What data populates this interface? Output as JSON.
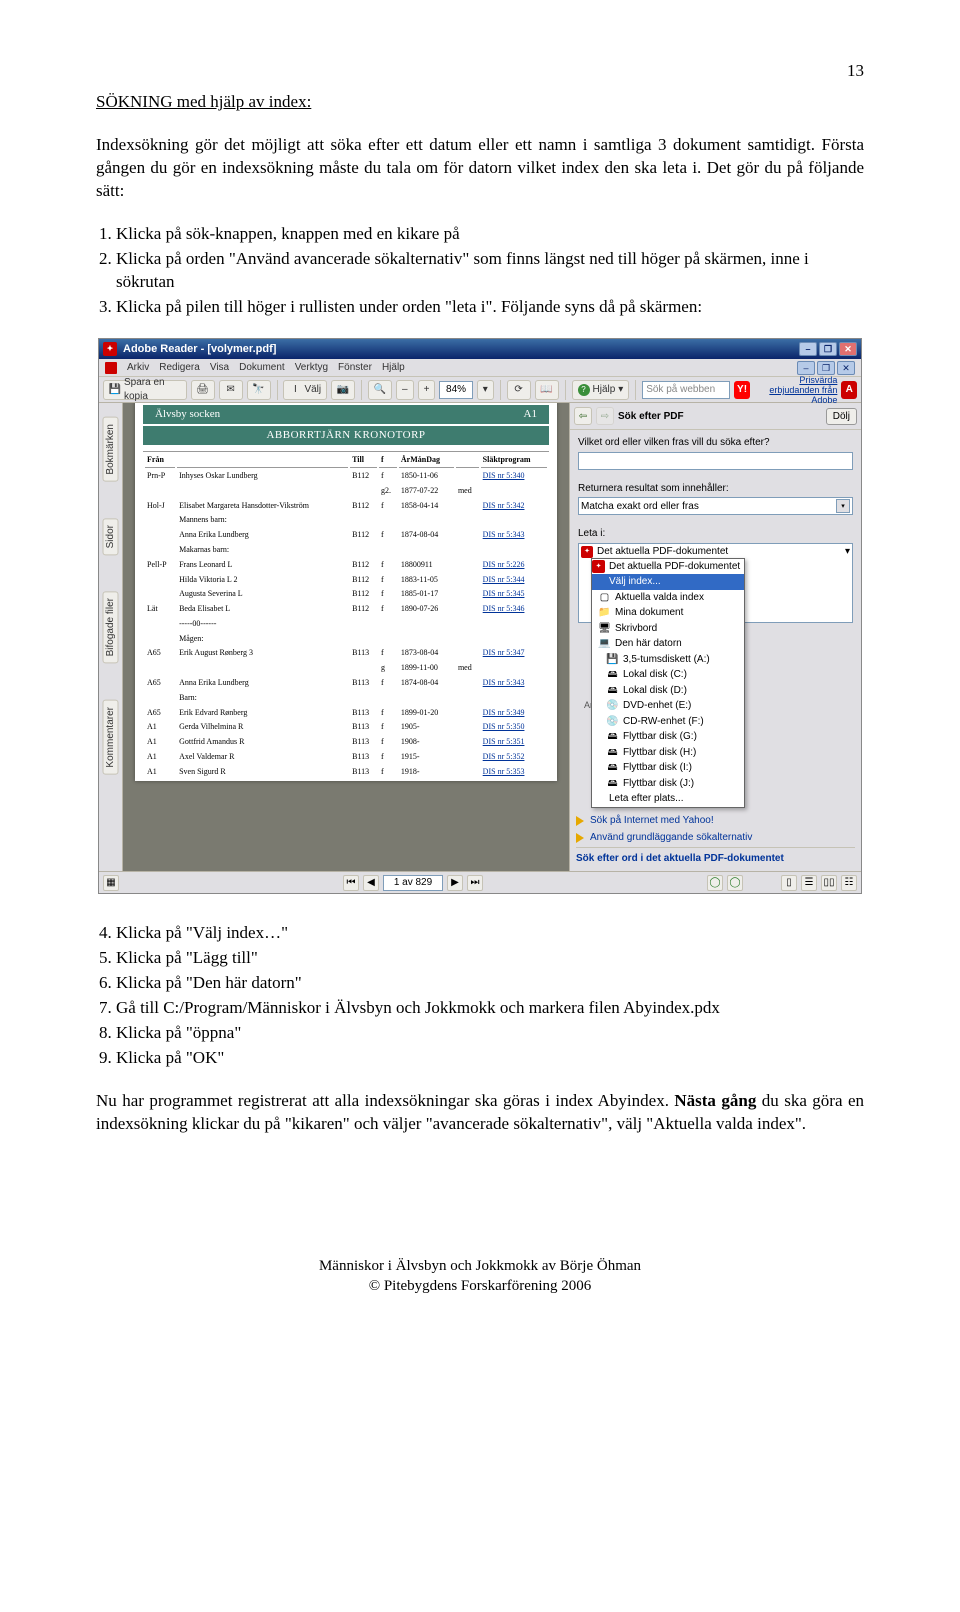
{
  "pageNumber": "13",
  "heading": "SÖKNING med hjälp av index:",
  "para1": "Indexsökning gör det möjligt att söka efter ett datum eller ett namn i samtliga 3 dokument samtidigt. Första gången du gör en indexsökning måste du tala om för datorn vilket index den ska leta i. Det gör du på följande sätt:",
  "steps1": [
    "Klicka på sök-knappen, knappen med en kikare på",
    "Klicka på orden \"Använd avancerade sökalternativ\" som finns längst ned till höger på skärmen, inne i sökrutan",
    "Klicka på pilen till höger i rullisten under orden \"leta i\". Följande syns då på skärmen:"
  ],
  "steps2": [
    "Klicka på  \"Välj index…\"",
    "Klicka på \"Lägg till\"",
    "Klicka på \"Den här datorn\"",
    "Gå till C:/Program/Människor i Älvsbyn och Jokkmokk och markera filen Abyindex.pdx",
    "Klicka på \"öppna\"",
    "Klicka på \"OK\""
  ],
  "para2": "Nu har programmet registrerat att alla indexsökningar ska göras i index Abyindex. Nästa gång du ska göra en indexsökning klickar du på \"kikaren\" och väljer \"avancerade sökalternativ\", välj \"Aktuella valda index\".",
  "footer1": "Människor i Älvsbyn och Jokkmokk av Börje Öhman",
  "footer2": "© Pitebygdens Forskarförening 2006",
  "shot": {
    "title": "Adobe Reader - [volymer.pdf]",
    "menu": [
      "Arkiv",
      "Redigera",
      "Visa",
      "Dokument",
      "Verktyg",
      "Fönster",
      "Hjälp"
    ],
    "toolbar": {
      "save": "Spara en kopia",
      "select": "Välj",
      "zoom": "84%",
      "help": "Hjälp",
      "searchPlaceholder": "Sök på webben",
      "promo": "Prisvärda erbjudanden från Adobe"
    },
    "leftTabs": [
      "Bokmärken",
      "Sidor",
      "Bifogade filer",
      "Kommentarer"
    ],
    "doc": {
      "banner1L": "Älvsby socken",
      "banner1R": "A1",
      "banner2": "ABBORRTJÄRN  KRONOTORP",
      "headers": [
        "Från",
        "",
        "Till",
        "f",
        "ÅrMånDag",
        "",
        "Släktprogram"
      ],
      "rows": [
        [
          "Prn-P",
          "Inhyses  Oskar Lundberg",
          "B112",
          "f",
          "1850-11-06",
          "",
          "DIS nr 5:340"
        ],
        [
          "",
          "",
          "",
          "g2.",
          "1877-07-22",
          "med",
          ""
        ],
        [
          "Hol-J",
          "Elisabet Margareta Hansdotter-Vikström",
          "B112",
          "f",
          "1858-04-14",
          "",
          "DIS nr 5:342"
        ],
        [
          "",
          "Mannens barn:",
          "",
          "",
          "",
          "",
          ""
        ],
        [
          "",
          "Anna Erika Lundberg",
          "B112",
          "f",
          "1874-08-04",
          "",
          "DIS nr 5:343"
        ],
        [
          "",
          "Makarnas barn:",
          "",
          "",
          "",
          "",
          ""
        ],
        [
          "Pell-P",
          "Frans Leonard L",
          "B112",
          "f",
          "18800911",
          "",
          "DIS nr 5:226"
        ],
        [
          "",
          "Hilda Viktoria L 2",
          "B112",
          "f",
          "1883-11-05",
          "",
          "DIS nr 5:344"
        ],
        [
          "",
          "Augusta Severina L",
          "B112",
          "f",
          "1885-01-17",
          "",
          "DIS nr 5:345"
        ],
        [
          "Lät",
          "Beda Elisabet L",
          "B112",
          "f",
          "1890-07-26",
          "",
          "DIS nr 5:346"
        ],
        [
          "",
          "-----00------",
          "",
          "",
          "",
          "",
          ""
        ],
        [
          "",
          "Mågen:",
          "",
          "",
          "",
          "",
          ""
        ],
        [
          "A65",
          "Erik August Rønberg 3",
          "B113",
          "f",
          "1873-08-04",
          "",
          "DIS nr 5:347"
        ],
        [
          "",
          "",
          "",
          "g",
          "1899-11-00",
          "med",
          ""
        ],
        [
          "A65",
          "Anna Erika Lundberg",
          "B113",
          "f",
          "1874-08-04",
          "",
          "DIS nr 5:343"
        ],
        [
          "",
          "Barn:",
          "",
          "",
          "",
          "",
          ""
        ],
        [
          "A65",
          "Erik Edvard Rønberg",
          "B113",
          "f",
          "1899-01-20",
          "",
          "DIS nr 5:349"
        ],
        [
          "A1",
          "Gerda Vilhelmina R",
          "B113",
          "f",
          "1905-",
          "",
          "DIS nr 5:350"
        ],
        [
          "A1",
          "Gottfrid Amandus R",
          "B113",
          "f",
          "1908-",
          "",
          "DIS nr 5:351"
        ],
        [
          "A1",
          "Axel Valdemar R",
          "B113",
          "f",
          "1915-",
          "",
          "DIS nr 5:352"
        ],
        [
          "A1",
          "Sven Sigurd R",
          "B113",
          "f",
          "1918-",
          "",
          "DIS nr 5:353"
        ]
      ]
    },
    "right": {
      "title": "Sök efter PDF",
      "hide": "Dölj",
      "q1": "Vilket ord eller vilken fras vill du söka efter?",
      "q2": "Returnera resultat som innehåller:",
      "matchMode": "Matcha exakt ord eller fras",
      "lookIn": "Leta i:",
      "lookRow1": "Det aktuella PDF-dokumentet",
      "popup": [
        "Det aktuella PDF-dokumentet",
        "Välj index...",
        "Aktuella valda index",
        "Mina dokument",
        "Skrivbord",
        "Den här datorn",
        "3,5-tumsdiskett (A:)",
        "Lokal disk (C:)",
        "Lokal disk (D:)",
        "DVD-enhet (E:)",
        "CD-RW-enhet (F:)",
        "Flyttbar disk (G:)",
        "Flyttbar disk (H:)",
        "Flyttbar disk (I:)",
        "Flyttbar disk (J:)",
        "Leta efter plats..."
      ],
      "links": [
        "Sök på Internet med Yahoo!",
        "Använd grundläggande sökalternativ",
        "Sök efter ord i det aktuella PDF-dokumentet"
      ]
    },
    "status": {
      "page": "1 av 829"
    }
  }
}
